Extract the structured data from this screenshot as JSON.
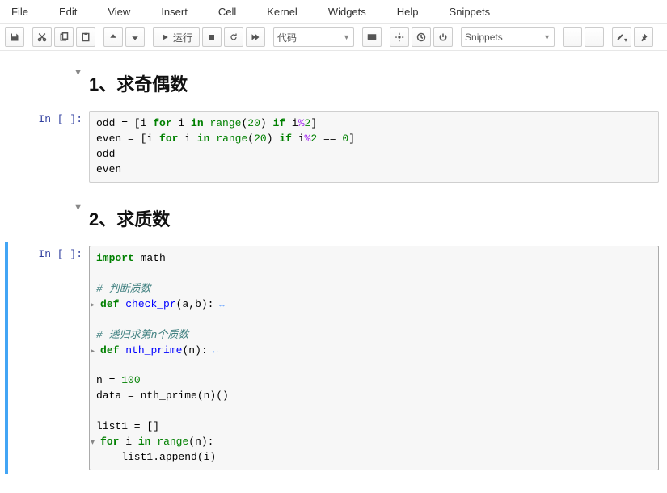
{
  "menubar": [
    "File",
    "Edit",
    "View",
    "Insert",
    "Cell",
    "Kernel",
    "Widgets",
    "Help",
    "Snippets"
  ],
  "toolbar": {
    "run_label": "运行",
    "celltype": "代码",
    "snippets": "Snippets"
  },
  "cells": [
    {
      "heading": "1、求奇偶数",
      "prompt": "In [ ]:",
      "code_tokens": [
        [
          [
            "odd = ["
          ],
          [
            "i ",
            ""
          ],
          [
            "for",
            "kw"
          ],
          [
            " i ",
            ""
          ],
          [
            "in",
            "kw"
          ],
          [
            " ",
            ""
          ],
          [
            "range",
            "builtin"
          ],
          [
            "(",
            ""
          ],
          [
            "20",
            "num"
          ],
          [
            ") ",
            ""
          ],
          [
            "if",
            "kw"
          ],
          [
            " i",
            ""
          ],
          [
            "%",
            "op"
          ],
          [
            "2",
            "num"
          ],
          [
            "]",
            ""
          ]
        ],
        [
          [
            "even = ["
          ],
          [
            "i ",
            ""
          ],
          [
            "for",
            "kw"
          ],
          [
            " i ",
            ""
          ],
          [
            "in",
            "kw"
          ],
          [
            " ",
            ""
          ],
          [
            "range",
            "builtin"
          ],
          [
            "(",
            ""
          ],
          [
            "20",
            "num"
          ],
          [
            ") ",
            ""
          ],
          [
            "if",
            "kw"
          ],
          [
            " i",
            ""
          ],
          [
            "%",
            "op"
          ],
          [
            "2",
            "num"
          ],
          [
            " == ",
            ""
          ],
          [
            "0",
            "num"
          ],
          [
            "]",
            ""
          ]
        ],
        [
          [
            "odd",
            ""
          ]
        ],
        [
          [
            "even",
            ""
          ]
        ]
      ]
    },
    {
      "heading": "2、求质数",
      "prompt": "In [ ]:",
      "code_tokens": [
        [
          [
            "import",
            "kw"
          ],
          [
            " math",
            ""
          ]
        ],
        [],
        [
          [
            "# 判断质数",
            "cmt"
          ]
        ],
        [
          [
            "▸",
            "marker"
          ],
          [
            "def",
            "kw"
          ],
          [
            " ",
            ""
          ],
          [
            "check_pr",
            "def"
          ],
          [
            "(a,b):",
            ""
          ],
          [
            "↔",
            "fold"
          ]
        ],
        [],
        [
          [
            "# 递归求第n个质数",
            "cmt"
          ]
        ],
        [
          [
            "▸",
            "marker"
          ],
          [
            "def",
            "kw"
          ],
          [
            " ",
            ""
          ],
          [
            "nth_prime",
            "def"
          ],
          [
            "(n):",
            ""
          ],
          [
            "↔",
            "fold"
          ]
        ],
        [],
        [
          [
            "n = ",
            ""
          ],
          [
            "100",
            "num"
          ]
        ],
        [
          [
            "data = nth_prime(n)()",
            ""
          ]
        ],
        [],
        [
          [
            "list1 = []",
            ""
          ]
        ],
        [
          [
            "▾",
            "marker"
          ],
          [
            "for",
            "kw"
          ],
          [
            " i ",
            ""
          ],
          [
            "in",
            "kw"
          ],
          [
            " ",
            ""
          ],
          [
            "range",
            "builtin"
          ],
          [
            "(n):",
            ""
          ]
        ],
        [
          [
            "    list1.append(i)",
            ""
          ]
        ]
      ]
    }
  ],
  "chart_data": null
}
